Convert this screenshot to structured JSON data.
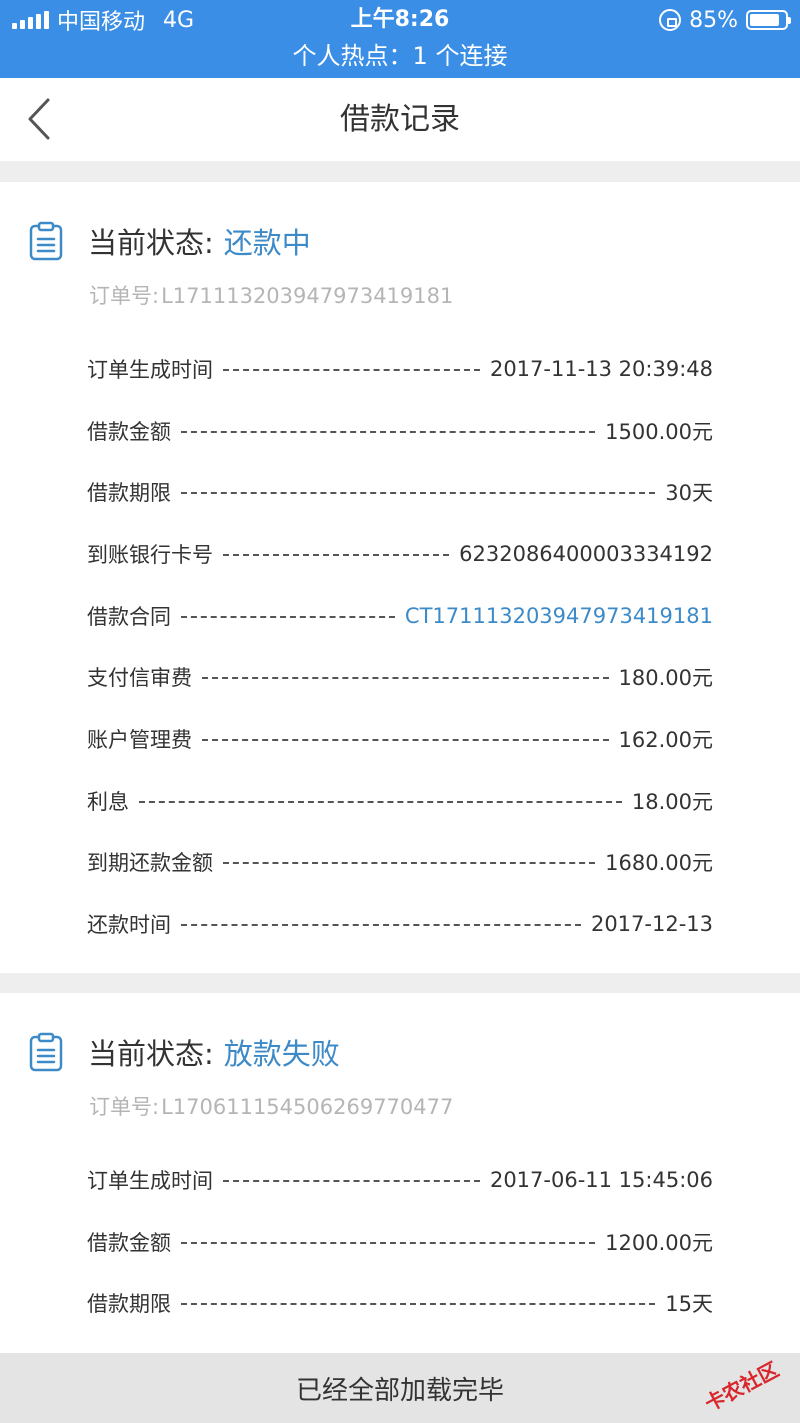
{
  "statusbar": {
    "carrier": "中国移动",
    "network": "4G",
    "time": "上午8:26",
    "battery": "85%",
    "battery_level": 0.85,
    "hotspot": "个人热点：1 个连接"
  },
  "nav": {
    "title": "借款记录",
    "back_icon": "chevron-left-icon"
  },
  "records": [
    {
      "status_label": "当前状态:",
      "status_value": "还款中",
      "order_no_label": "订单号:",
      "order_no": "L17111320394797341918​1",
      "rows": [
        {
          "label": "订单生成时间",
          "value": "2017-11-13 20:39:48"
        },
        {
          "label": "借款金额",
          "value": "1500.00元"
        },
        {
          "label": "借款期限",
          "value": "30天"
        },
        {
          "label": "到账银行卡号",
          "value": "6232086400003334192"
        },
        {
          "label": "借款合同",
          "value": "CT171113203947973419181"
        },
        {
          "label": "支付信审费",
          "value": "180.00元"
        },
        {
          "label": "账户管理费",
          "value": "162.00元"
        },
        {
          "label": "利息",
          "value": "18.00元"
        },
        {
          "label": "到期还款金额",
          "value": "1680.00元"
        },
        {
          "label": "还款时间",
          "value": "2017-12-13"
        }
      ]
    },
    {
      "status_label": "当前状态:",
      "status_value": "放款失败",
      "order_no_label": "订单号:",
      "order_no": "L170611154506269770477",
      "rows": [
        {
          "label": "订单生成时间",
          "value": "2017-06-11 15:45:06"
        },
        {
          "label": "借款金额",
          "value": "1200.00元"
        },
        {
          "label": "借款期限",
          "value": "15天"
        }
      ]
    }
  ],
  "footer": {
    "text": "已经全部加载完毕"
  },
  "watermark": {
    "text": "卡农社区"
  },
  "colors": {
    "status_bar": "#3a8ee6",
    "accent": "#3d8ac8",
    "watermark": "#d9262c"
  }
}
